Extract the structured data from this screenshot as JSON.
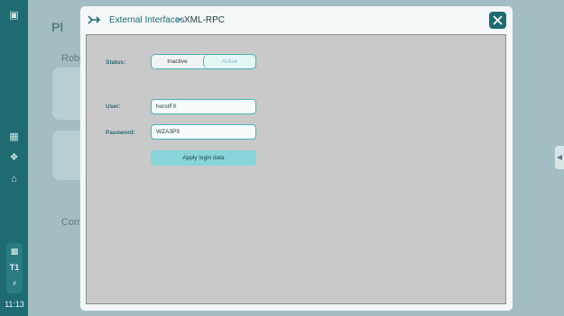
{
  "background": {
    "clock": "11:13",
    "side_items": [
      "T1"
    ],
    "truncated_labels": [
      "Pl",
      "Robo",
      "Comp"
    ]
  },
  "modal": {
    "breadcrumb": {
      "parent": "External Interfaces",
      "separator": ">",
      "current": "XML-RPC"
    },
    "status": {
      "label": "Status:",
      "options": [
        "Inactive",
        "Active"
      ],
      "selected": "Inactive"
    },
    "user": {
      "label": "User:",
      "value": "horstFX"
    },
    "password": {
      "label": "Password:",
      "value": "WZA3P9"
    },
    "apply_label": "Apply login data"
  },
  "colors": {
    "accent": "#1f6b72",
    "border_accent": "#49b3ba",
    "button": "#88d4d8"
  }
}
